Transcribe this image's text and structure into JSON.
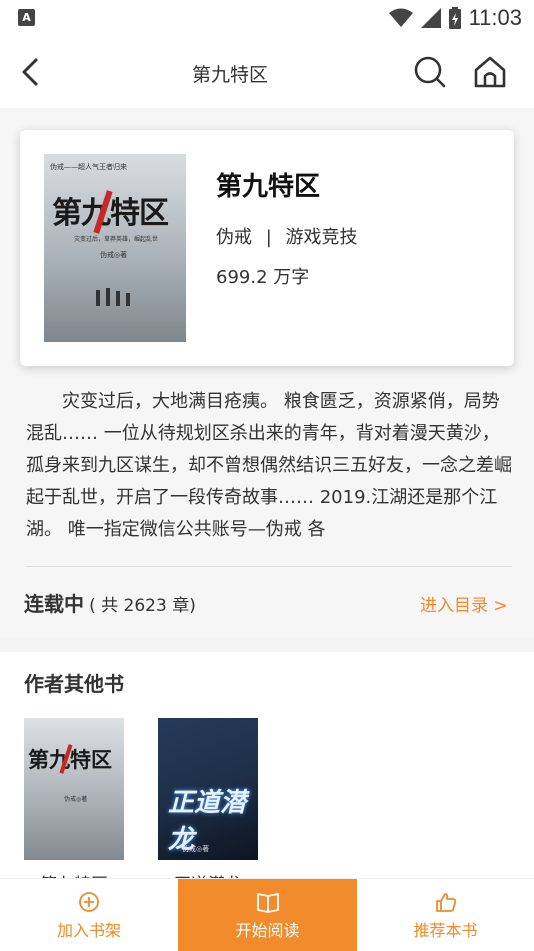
{
  "status_bar": {
    "time": "11:03",
    "left_badge": "A"
  },
  "nav": {
    "title": "第九特区"
  },
  "book": {
    "title": "第九特区",
    "author": "伪戒",
    "separator": "|",
    "category": "游戏竞技",
    "words": "699.2 万字",
    "cover_text": {
      "small": "伪戒——超人气王者归来",
      "big": "第九特区",
      "sub": "灾变过后，草莽英雄，崛起乱世",
      "author": "伪戒◎著"
    }
  },
  "description": "灾变过后，大地满目疮痍。 粮食匮乏，资源紧俏，局势混乱…… 一位从待规划区杀出来的青年，背对着漫天黄沙，孤身来到九区谋生，却不曾想偶然结识三五好友，一念之差崛起于乱世，开启了一段传奇故事…… 2019.江湖还是那个江湖。 唯一指定微信公共账号—伪戒 各",
  "serial": {
    "status": "连载中",
    "count": "( 共 2623 章)",
    "toc_link": "进入目录 >"
  },
  "other_books": {
    "heading": "作者其他书",
    "items": [
      {
        "name": "第九特区",
        "cover_big": "第九特区",
        "cover_author": "伪戒◎著"
      },
      {
        "name": "正道潜龙",
        "cover_big": "正道潜龙",
        "cover_author": "伪戒◎著"
      }
    ]
  },
  "bottom_bar": {
    "add_shelf": "加入书架",
    "start_read": "开始阅读",
    "recommend": "推荐本书"
  },
  "colors": {
    "accent": "#f28b2c",
    "link": "#f08a2a"
  }
}
